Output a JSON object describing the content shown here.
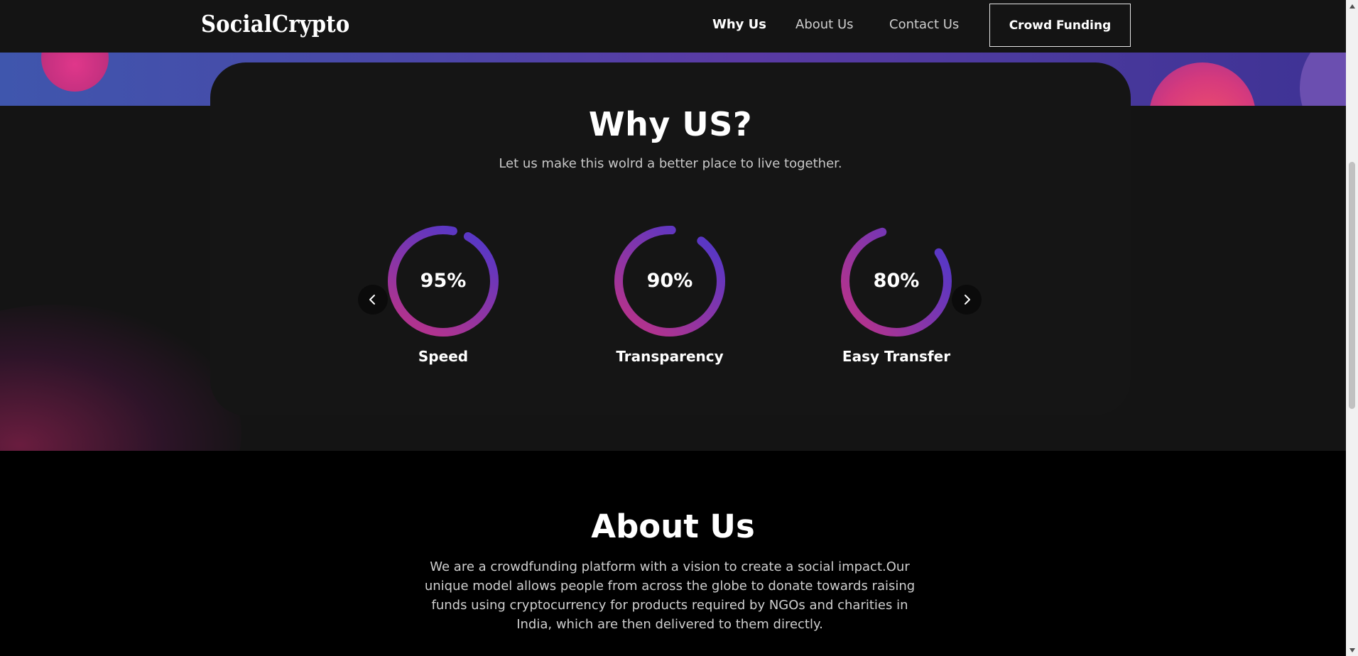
{
  "header": {
    "logo": "SocialCrypto",
    "nav": [
      {
        "label": "Why Us",
        "active": true
      },
      {
        "label": "About Us",
        "active": false
      },
      {
        "label": "Contact Us",
        "active": false
      }
    ],
    "cta_label": "Crowd Funding"
  },
  "why": {
    "title": "Why US?",
    "subtitle": "Let us make this wolrd a better place to live together.",
    "stats": [
      {
        "value": "95%",
        "label": "Speed",
        "percent": 95
      },
      {
        "value": "90%",
        "label": "Transparency",
        "percent": 90
      },
      {
        "value": "80%",
        "label": "Easy Transfer",
        "percent": 80
      }
    ]
  },
  "about": {
    "title": "About Us",
    "text": "We are a crowdfunding platform with a vision to create a social impact.Our unique model allows people from across the globe to donate towards raising funds using cryptocurrency for products required by NGOs and charities in India, which are then delivered to them directly."
  },
  "colors": {
    "ring_start": "#b0338f",
    "ring_end": "#5a37c4",
    "background": "#141414",
    "card": "#151515"
  },
  "icons": {
    "prev": "chevron-left-icon",
    "next": "chevron-right-icon"
  }
}
